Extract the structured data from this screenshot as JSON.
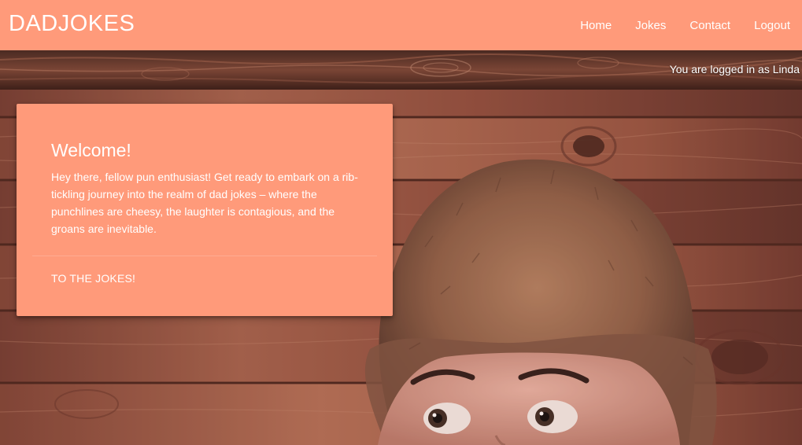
{
  "navbar": {
    "brand": "DADJOKES",
    "links": [
      {
        "label": "Home"
      },
      {
        "label": "Jokes"
      },
      {
        "label": "Contact"
      },
      {
        "label": "Logout"
      }
    ]
  },
  "status": {
    "logged_in_text": "You are logged in as Linda"
  },
  "welcome_card": {
    "title": "Welcome!",
    "text": "Hey there, fellow pun enthusiast! Get ready to embark on a rib-tickling journey into the realm of dad jokes – where the punchlines are cheesy, the laughter is contagious, and the groans are inevitable.",
    "action_label": "TO THE JOKES!"
  },
  "colors": {
    "accent": "#ff9a7a",
    "text_on_accent": "#ffffff",
    "wood_dark": "#5a2e25",
    "wood_light": "#a8634c"
  }
}
